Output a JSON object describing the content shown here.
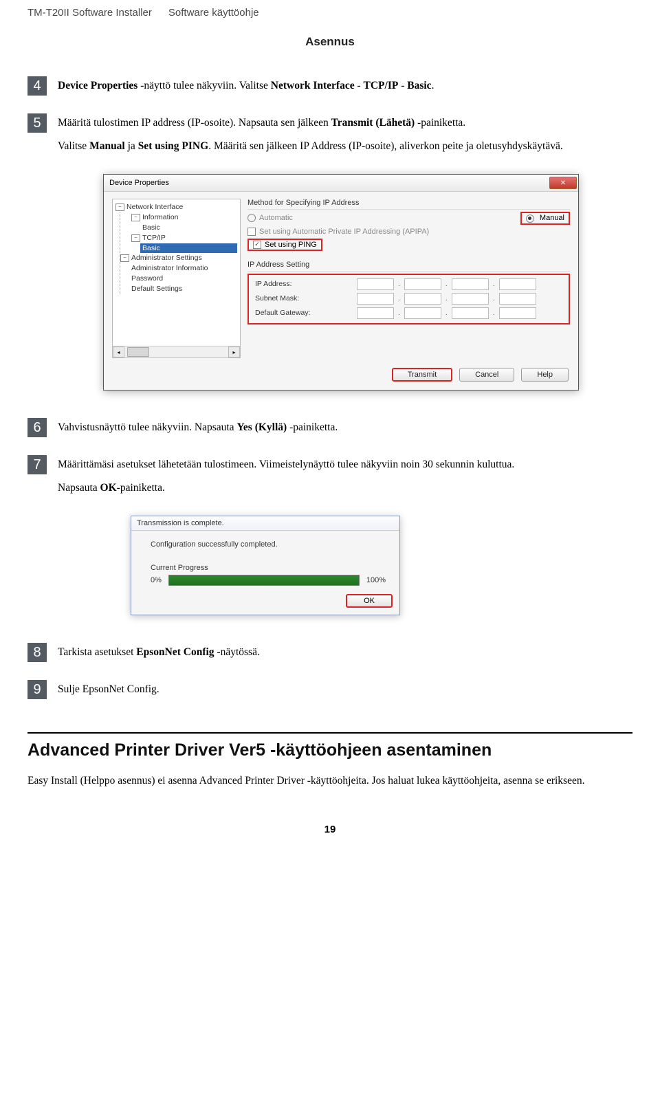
{
  "header": {
    "left": "TM-T20II Software Installer",
    "right": "Software käyttöohje"
  },
  "section_title": "Asennus",
  "steps": {
    "s4": {
      "num": "4",
      "html": "<b>Device Properties</b> -näyttö tulee näkyviin. Valitse <b>Network Interface</b> - <b>TCP/IP</b> - <b>Basic</b>."
    },
    "s5": {
      "num": "5",
      "p1": "Määritä tulostimen IP address (IP-osoite). Napsauta sen jälkeen <b>Transmit (Lähetä)</b> -painiketta.",
      "p2": "Valitse <b>Manual</b> ja <b>Set using PING</b>. Määritä sen jälkeen IP Address (IP-osoite), aliverkon peite ja oletusyhdyskäytävä."
    },
    "s6": {
      "num": "6",
      "html": "Vahvistusnäyttö tulee näkyviin. Napsauta <b>Yes (Kyllä)</b> -painiketta."
    },
    "s7": {
      "num": "7",
      "p1": "Määrittämäsi asetukset lähetetään tulostimeen. Viimeistelynäyttö tulee näkyviin noin 30 sekunnin kuluttua.",
      "p2": "Napsauta <b>OK</b>-painiketta."
    },
    "s8": {
      "num": "8",
      "html": "Tarkista asetukset <b>EpsonNet Config</b> -näytössä."
    },
    "s9": {
      "num": "9",
      "html": "Sulje EpsonNet Config."
    }
  },
  "dialog1": {
    "title": "Device Properties",
    "tree": {
      "network_interface": "Network Interface",
      "information": "Information",
      "basic1": "Basic",
      "tcpip": "TCP/IP",
      "basic2": "Basic",
      "admin": "Administrator Settings",
      "admin_info": "Administrator Informatio",
      "password": "Password",
      "defaults": "Default Settings"
    },
    "method_label": "Method for Specifying IP Address",
    "automatic": "Automatic",
    "manual": "Manual",
    "apipa": "Set using Automatic Private IP Addressing (APIPA)",
    "set_ping": "Set using PING",
    "ip_setting_label": "IP Address Setting",
    "rows": {
      "ip": "IP Address:",
      "mask": "Subnet Mask:",
      "gw": "Default Gateway:"
    },
    "buttons": {
      "transmit": "Transmit",
      "cancel": "Cancel",
      "help": "Help"
    }
  },
  "dialog2": {
    "title": "Transmission is complete.",
    "msg": "Configuration successfully completed.",
    "progress_label": "Current Progress",
    "pct0": "0%",
    "pct100": "100%",
    "ok": "OK"
  },
  "h2": "Advanced Printer Driver Ver5 -käyttöohjeen asentaminen",
  "body_p": "Easy Install (Helppo asennus) ei asenna Advanced Printer Driver -käyttöohjeita. Jos haluat lukea käyttöohjeita, asenna se erikseen.",
  "page_num": "19"
}
